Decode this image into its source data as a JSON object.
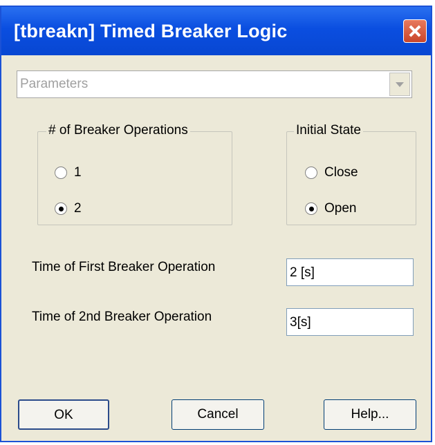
{
  "window": {
    "title": "[tbreakn] Timed Breaker Logic"
  },
  "dropdown": {
    "value": "Parameters"
  },
  "group_operations": {
    "legend": "# of Breaker Operations",
    "options": [
      {
        "label": "1",
        "selected": false
      },
      {
        "label": "2",
        "selected": true
      }
    ]
  },
  "group_initial_state": {
    "legend": "Initial State",
    "options": [
      {
        "label": "Close",
        "selected": false
      },
      {
        "label": "Open",
        "selected": true
      }
    ]
  },
  "fields": {
    "first_op": {
      "label": "Time of First Breaker Operation",
      "value": "2 [s]"
    },
    "second_op": {
      "label": "Time of 2nd Breaker Operation",
      "value": "3[s]"
    }
  },
  "buttons": {
    "ok": "OK",
    "cancel": "Cancel",
    "help": "Help..."
  },
  "colors": {
    "titlebar": "#0a4ee0",
    "dialog_bg": "#ece9d8",
    "close_button": "#c9452a"
  }
}
